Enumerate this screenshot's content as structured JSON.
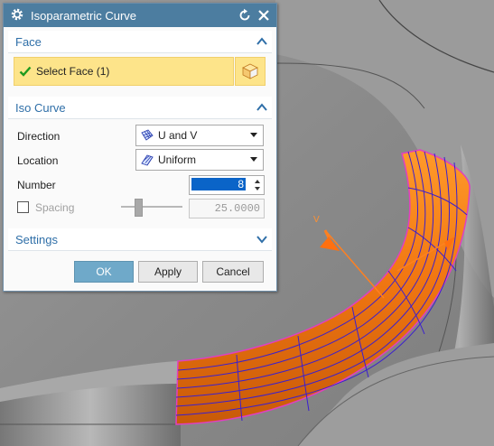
{
  "dialog": {
    "title": "Isoparametric Curve",
    "face_section": {
      "header": "Face",
      "select_label": "Select Face (1)"
    },
    "iso_section": {
      "header": "Iso Curve",
      "direction_label": "Direction",
      "direction_value": "U and V",
      "location_label": "Location",
      "location_value": "Uniform",
      "number_label": "Number",
      "number_value": "8",
      "spacing_label": "Spacing",
      "spacing_value": "25.0000"
    },
    "settings_section": {
      "header": "Settings"
    },
    "buttons": {
      "ok": "OK",
      "apply": "Apply",
      "cancel": "Cancel"
    }
  },
  "viewport": {
    "axis_label": "V"
  },
  "icons": {
    "title": "gear-icon",
    "reset": "reset-icon",
    "close": "close-icon",
    "check": "checkmark-icon",
    "cube": "cube-icon",
    "collapse": "chevron-up-icon",
    "expand": "chevron-down-icon"
  },
  "colors": {
    "titlebar": "#4c7da0",
    "section_text": "#2f6fa8",
    "selection_row": "#fde48a",
    "face_fill": "#f07a14",
    "iso_curve": "#3a1fd0",
    "face_edge": "#e040c0",
    "ok_button": "#6fa9c9"
  }
}
